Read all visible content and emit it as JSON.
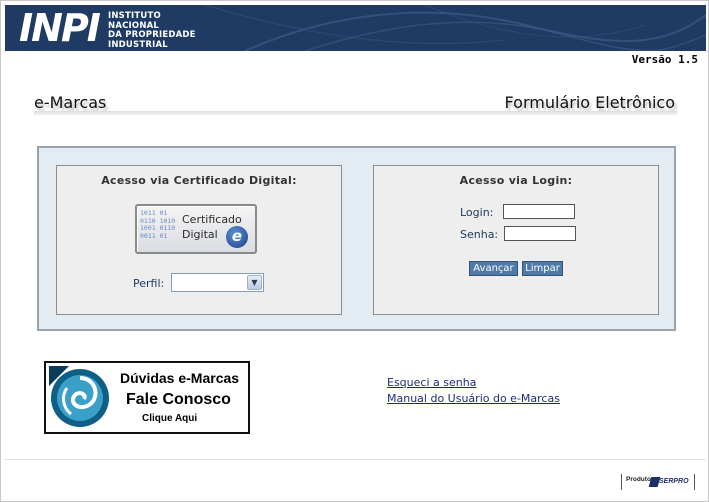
{
  "header": {
    "logo_mark": "INPI",
    "logo_lines": [
      "INSTITUTO",
      "NACIONAL",
      "DA PROPRIEDADE",
      "INDUSTRIAL"
    ],
    "colors": {
      "background": "#1f3a63",
      "text": "#ffffff"
    }
  },
  "version": "Versão 1.5",
  "title": {
    "left": "e-Marcas",
    "right": "Formulário Eletrônico"
  },
  "certificate_access": {
    "title": "Acesso via Certificado Digital:",
    "button_line1": "Certificado",
    "button_line2": "Digital",
    "button_icon": "e-icon",
    "perfil_label": "Perfil:",
    "perfil_value": ""
  },
  "login_access": {
    "title": "Acesso via Login:",
    "login_label": "Login:",
    "login_value": "",
    "senha_label": "Senha:",
    "senha_value": "",
    "advance_button": "Avançar",
    "clear_button": "Limpar",
    "button_color": "#4f7aa7"
  },
  "help_banner": {
    "line1": "Dúvidas e-Marcas",
    "line2": "Fale Conosco",
    "line3": "Clique Aqui"
  },
  "links": {
    "forgot_password": "Esqueci a senha",
    "manual": "Manual do Usuário do e-Marcas"
  },
  "footer": {
    "produto": "Produto",
    "brand": "SERPRO"
  }
}
